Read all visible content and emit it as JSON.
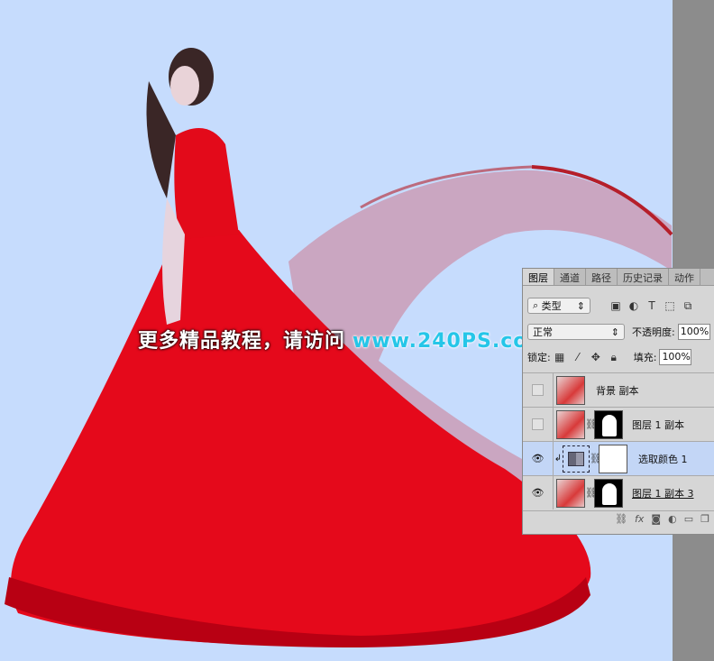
{
  "watermark": {
    "text": "更多精品教程，请访问",
    "url": "www.240PS.com"
  },
  "layers_panel": {
    "tabs": [
      "图层",
      "通道",
      "路径",
      "历史记录",
      "动作"
    ],
    "filter_label": "类型",
    "blend_mode": "正常",
    "opacity_label": "不透明度:",
    "opacity_value": "100%",
    "lock_label": "锁定:",
    "fill_label": "填充:",
    "fill_value": "100%",
    "layers": [
      {
        "name": "背景 副本",
        "visible": false
      },
      {
        "name": "图层 1 副本",
        "visible": false
      },
      {
        "name": "选取颜色 1",
        "visible": true,
        "selected": true
      },
      {
        "name": "图层 1 副本 3",
        "visible": true
      }
    ]
  }
}
